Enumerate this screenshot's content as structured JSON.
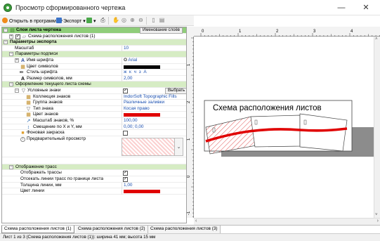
{
  "window": {
    "title": "Просмотр сформированного чертежа",
    "minimize": "—",
    "close": "✕"
  },
  "toolbar": {
    "open_label": "Открыть в программе",
    "export_label": "Экспорт"
  },
  "layers": {
    "header": "Слои листа чертежа",
    "naming_button": "Именование слоёв",
    "item": "Схема расположения листов (1)"
  },
  "props": {
    "export_params": "Параметры экспорта",
    "scale_label": "Масштаб",
    "scale_value": "10",
    "caption_params": "Параметры подписи",
    "font_name_label": "Имя шрифта",
    "font_name_value": "Arial",
    "symbol_color_label": "Цвет символов",
    "font_style_label": "Стиль шрифта",
    "font_style_value": "ж к ч з А",
    "symbol_size_label": "Размер символов, мм",
    "symbol_size_value": "2,00",
    "sheet_style": "Оформление текущего листа схемы",
    "symbols_label": "Условные знаки",
    "choose_button": "Выбрать",
    "collection_label": "Коллекция знаков",
    "collection_value": "IndorSoft Topographic Fills",
    "group_label": "Группа знаков",
    "group_value": "Различные заливки",
    "type_label": "Тип знака",
    "type_value": "Косая право",
    "color_label": "Цвет знаков",
    "sym_scale_label": "Масштаб знаков, %",
    "sym_scale_value": "100,00",
    "offset_label": "Смещение по X и Y, мм",
    "offset_value": "0,00; 0,00",
    "bg_fill_label": "Фоновая закраска",
    "preview_label": "Предварительный просмотр",
    "routes_display": "Отображение трасс",
    "show_routes_label": "Отображать трассы",
    "clip_routes_label": "Отсекать линии трасс по границе листа",
    "line_width_label": "Толщина линии, мм",
    "line_width_value": "1,00",
    "line_color_label": "Цвет линии"
  },
  "tabs": [
    "Схема расположения листов (1)",
    "Схема расположения листов (2)",
    "Схема расположения листов (3)"
  ],
  "status": "Лист 1 из 3 (Схема расположения листов (1)): ширина 41 мм; высота 15 мм",
  "drawing": {
    "title": "Схема расположения листов",
    "ruler_h": [
      "0",
      "1",
      "2",
      "3",
      "4"
    ],
    "ruler_v": [
      "1",
      "2",
      "1",
      "0",
      "-1"
    ]
  },
  "colors": {
    "accent_green": "#8fcd7a",
    "category_green": "#d6ecc4",
    "route_red": "#e00000",
    "hatch_red": "#e05050",
    "link_blue": "#1a4fb0"
  }
}
